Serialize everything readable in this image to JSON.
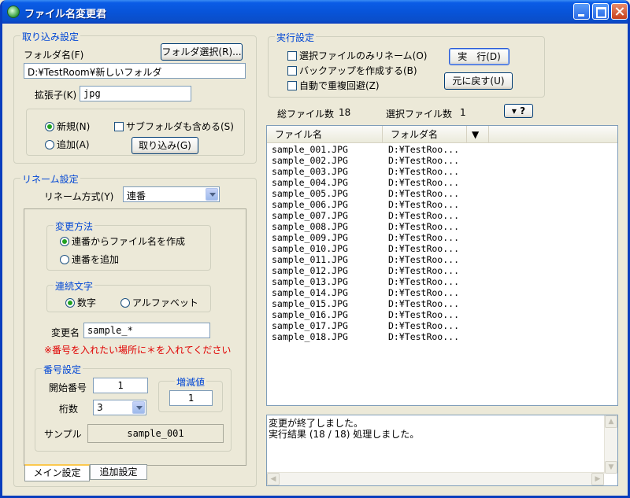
{
  "window": {
    "title": "ファイル名変更君"
  },
  "import": {
    "legend": "取り込み設定",
    "folder_label": "フォルダ名(F)",
    "folder_button": "フォルダ選択(R)...",
    "folder_value": "D:¥TestRoom¥新しいフォルダ",
    "ext_label": "拡張子(K)",
    "ext_value": "jpg",
    "radio_new": "新規(N)",
    "radio_add": "追加(A)",
    "include_subfolders": "サブフォルダも含める(S)",
    "import_button": "取り込み(G)"
  },
  "rename": {
    "legend": "リネーム設定",
    "method_label": "リネーム方式(Y)",
    "method_value": "連番",
    "change_legend": "変更方法",
    "change_opt1": "連番からファイル名を作成",
    "change_opt2": "連番を追加",
    "seq_legend": "連続文字",
    "seq_opt1": "数字",
    "seq_opt2": "アルファベット",
    "name_label": "変更名",
    "name_value": "sample_*",
    "warning": "※番号を入れたい場所に＊を入れてください",
    "number_legend": "番号設定",
    "start_label": "開始番号",
    "start_value": "1",
    "digits_label": "桁数",
    "digits_value": "3",
    "step_legend": "増減値",
    "step_value": "1",
    "sample_label": "サンプル",
    "sample_value": "sample_001"
  },
  "tabs": {
    "main": "メイン設定",
    "extra": "追加設定"
  },
  "exec": {
    "legend": "実行設定",
    "opt_selected_only": "選択ファイルのみリネーム(O)",
    "opt_backup": "バックアップを作成する(B)",
    "opt_avoid_dup": "自動で重複回避(Z)",
    "run_button": "実　行(D)",
    "undo_button": "元に戻す(U)"
  },
  "counts": {
    "total_label": "総ファイル数",
    "total_value": "18",
    "selected_label": "選択ファイル数",
    "selected_value": "1",
    "help_button": "▾ ?"
  },
  "list": {
    "col_file": "ファイル名",
    "col_folder": "フォルダ名",
    "col_sort": "▼",
    "rows": [
      {
        "file": "sample_001.JPG",
        "folder": "D:¥TestRoo..."
      },
      {
        "file": "sample_002.JPG",
        "folder": "D:¥TestRoo..."
      },
      {
        "file": "sample_003.JPG",
        "folder": "D:¥TestRoo..."
      },
      {
        "file": "sample_004.JPG",
        "folder": "D:¥TestRoo..."
      },
      {
        "file": "sample_005.JPG",
        "folder": "D:¥TestRoo..."
      },
      {
        "file": "sample_006.JPG",
        "folder": "D:¥TestRoo..."
      },
      {
        "file": "sample_007.JPG",
        "folder": "D:¥TestRoo..."
      },
      {
        "file": "sample_008.JPG",
        "folder": "D:¥TestRoo..."
      },
      {
        "file": "sample_009.JPG",
        "folder": "D:¥TestRoo..."
      },
      {
        "file": "sample_010.JPG",
        "folder": "D:¥TestRoo..."
      },
      {
        "file": "sample_011.JPG",
        "folder": "D:¥TestRoo..."
      },
      {
        "file": "sample_012.JPG",
        "folder": "D:¥TestRoo..."
      },
      {
        "file": "sample_013.JPG",
        "folder": "D:¥TestRoo..."
      },
      {
        "file": "sample_014.JPG",
        "folder": "D:¥TestRoo..."
      },
      {
        "file": "sample_015.JPG",
        "folder": "D:¥TestRoo..."
      },
      {
        "file": "sample_016.JPG",
        "folder": "D:¥TestRoo..."
      },
      {
        "file": "sample_017.JPG",
        "folder": "D:¥TestRoo..."
      },
      {
        "file": "sample_018.JPG",
        "folder": "D:¥TestRoo..."
      }
    ]
  },
  "log": {
    "line1": "変更が終了しました。",
    "line2": "実行結果 (18 / 18) 処理しました。"
  }
}
